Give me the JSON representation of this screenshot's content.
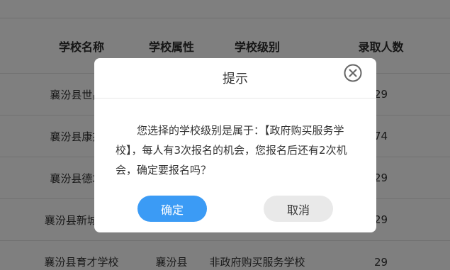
{
  "table": {
    "headers": [
      "学校名称",
      "学校属性",
      "学校级别",
      "录取人数"
    ],
    "rows": [
      [
        "襄汾县世昌...",
        "",
        "",
        "29"
      ],
      [
        "襄汾县康杰...",
        "",
        "",
        "74"
      ],
      [
        "襄汾县德才...",
        "",
        "",
        "29"
      ],
      [
        "襄汾县新城镇...",
        "",
        "",
        "29"
      ],
      [
        "襄汾县育才学校",
        "襄汾县",
        "非政府购买服务学校",
        "29"
      ]
    ]
  },
  "dialog": {
    "title": "提示",
    "message": "您选择的学校级别是属于：【政府购买服务学校】，每人有3次报名的机会，您报名后还有2次机会，确定要报名吗？",
    "confirm_label": "确定",
    "cancel_label": "取消",
    "close_icon": "close-circle-icon"
  },
  "colors": {
    "confirm": "#3b9bf5",
    "cancel": "#e9e9e9",
    "overlay": "rgba(0,0,0,0.5)"
  }
}
